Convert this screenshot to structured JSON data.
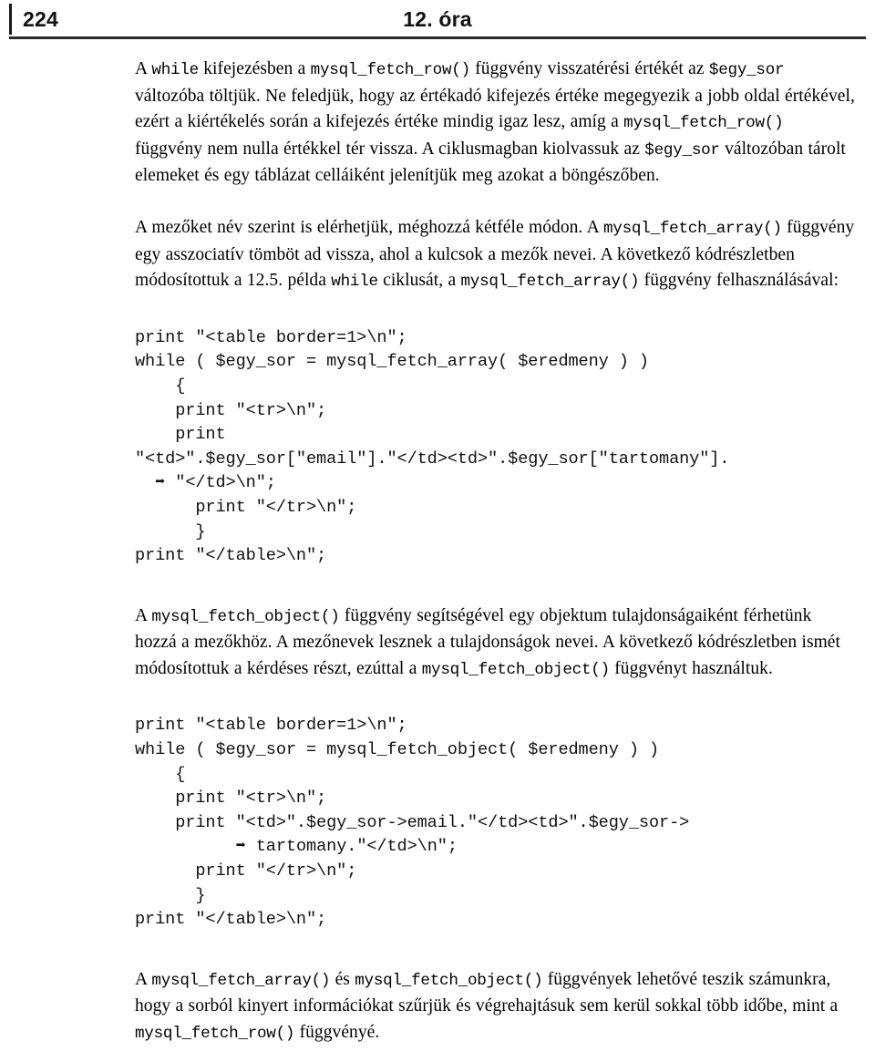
{
  "page": {
    "folio": "224",
    "running_title": "12. óra"
  },
  "body": {
    "para1": [
      "A ",
      "while",
      " kifejezésben a ",
      "mysql_fetch_row()",
      " függvény visszatérési értékét az ",
      "$egy_sor",
      " változóba töltjük. Ne feledjük, hogy az értékadó kifejezés értéke megegyezik a jobb oldal értékével, ezért a kiértékelés során a kifejezés értéke mindig igaz lesz, amíg a ",
      "mysql_fetch_row()",
      " függvény nem nulla értékkel tér vissza. A ciklusmagban kiolvassuk az ",
      "$egy_sor",
      " változóban tárolt elemeket és egy táblázat celláiként jelenítjük meg azokat a böngészőben."
    ],
    "para1_text": "A while kifejezésben a mysql_fetch_row() függvény visszatérési értékét az $egy_sor változóba töltjük. Ne feledjük, hogy az értékadó kifejezés értéke megegyezik a jobb oldal értékével, ezért a kiértékelés során a kifejezés értéke mindig igaz lesz, amíg a mysql_fetch_row() függvény nem nulla értékkel tér vissza. A ciklusmagban kiolvassuk az $egy_sor változóban tárolt elemeket és egy táblázat celláiként jelenítjük meg azokat a böngészőben.",
    "para2_text": "A mezőket név szerint is elérhetjük, méghozzá kétféle módon. A mysql_fetch_array() függvény egy asszociatív tömböt ad vissza, ahol a kulcsok a mezők nevei. A következő kódrészletben módosítottuk a 12.5. példa while ciklusát, a mysql_fetch_array() függvény felhasználásával:",
    "para3_text": "A mysql_fetch_object() függvény segítségével egy objektum tulajdonságaiként férhetünk hozzá a mezőkhöz. A mezőnevek lesznek a tulajdonságok nevei. A következő kódrészletben ismét módosítottuk a kérdéses részt, ezúttal a mysql_fetch_object() függvényt használtuk.",
    "para4_text": "A mysql_fetch_array() és mysql_fetch_object() függvények lehetővé teszik számunkra, hogy a sorból kinyert információkat szűrjük és végrehajtásuk sem kerül sokkal több időbe, mint a mysql_fetch_row() függvényé.",
    "fragments": {
      "p1_a": "A ",
      "p1_code1": "while",
      "p1_b": " kifejezésben a ",
      "p1_code2": "mysql_fetch_row()",
      "p1_c": " függvény visszatérési értékét az ",
      "p1_code3": "$egy_sor",
      "p1_d": " változóba töltjük. Ne feledjük, hogy az értékadó kifejezés értéke megegyezik a jobb oldal értékével, ezért a kiértékelés során a kifejezés értéke mindig igaz lesz, amíg a ",
      "p1_code4": "mysql_fetch_row()",
      "p1_e": " függvény nem nulla értékkel tér vissza. A ciklusmagban kiolvassuk az ",
      "p1_code5": "$egy_sor",
      "p1_f": " változóban tárolt elemeket és egy táblázat celláiként jelenítjük meg azokat a böngészőben.",
      "p2_a": "A mezőket név szerint is elérhetjük, méghozzá kétféle módon. A ",
      "p2_code1": "mysql_fetch_array()",
      "p2_b": " függvény egy asszociatív tömböt ad vissza, ahol a kulcsok a mezők nevei. A következő kódrészletben módosítottuk a 12.5. példa ",
      "p2_code2": "while",
      "p2_c": " ciklusát, a ",
      "p2_code3": "mysql_fetch_array()",
      "p2_d": " függvény felhasználásával:",
      "p3_a": "A ",
      "p3_code1": "mysql_fetch_object()",
      "p3_b": " függvény segítségével egy objektum tulajdonságaiként férhetünk hozzá a mezőkhöz. A mezőnevek lesznek a tulajdonságok nevei. A következő kódrészletben ismét módosítottuk a kérdéses részt, ezúttal a ",
      "p3_code2": "mysql_fetch_object()",
      "p3_c": " függvényt használtuk.",
      "p4_a": "A ",
      "p4_code1": "mysql_fetch_array()",
      "p4_b": " és ",
      "p4_code2": "mysql_fetch_object()",
      "p4_c": " függvények lehetővé teszik számunkra, hogy a sorból kinyert információkat szűrjük és végrehajtásuk sem kerül sokkal több időbe, mint a ",
      "p4_code3": "mysql_fetch_row()",
      "p4_d": " függvényé."
    }
  },
  "code_block_1": {
    "language": "php",
    "wrap_marker": "➡",
    "lines": [
      "print \"<table border=1>\\n\";",
      "while ( $egy_sor = mysql_fetch_array( $eredmeny ) )",
      "    {",
      "    print \"<tr>\\n\";",
      "    print",
      "\"<td>\".$egy_sor[\"email\"].\"</td><td>\".$egy_sor[\"tartomany\"].",
      "  ➡ \"</td>\\n\";",
      "      print \"</tr>\\n\";",
      "      }",
      "print \"</table>\\n\";"
    ],
    "text": "print \"<table border=1>\\n\";\nwhile ( $egy_sor = mysql_fetch_array( $eredmeny ) )\n    {\n    print \"<tr>\\n\";\n    print\n\"<td>\".$egy_sor[\"email\"].\"</td><td>\".$egy_sor[\"tartomany\"].\n  ➡ \"</td>\\n\";\n      print \"</tr>\\n\";\n      }\nprint \"</table>\\n\";"
  },
  "code_block_2": {
    "language": "php",
    "wrap_marker": "➡",
    "lines": [
      "print \"<table border=1>\\n\";",
      "while ( $egy_sor = mysql_fetch_object( $eredmeny ) )",
      "    {",
      "    print \"<tr>\\n\";",
      "    print \"<td>\".$egy_sor->email.\"</td><td>\".$egy_sor->",
      "          ➡ tartomany.\"</td>\\n\";",
      "      print \"</tr>\\n\";",
      "      }",
      "print \"</table>\\n\";"
    ],
    "text": "print \"<table border=1>\\n\";\nwhile ( $egy_sor = mysql_fetch_object( $eredmeny ) )\n    {\n    print \"<tr>\\n\";\n    print \"<td>\".$egy_sor->email.\"</td><td>\".$egy_sor->\n          ➡ tartomany.\"</td>\\n\";\n      print \"</tr>\\n\";\n      }\nprint \"</table>\\n\";"
  },
  "colors": {
    "text": "#000000",
    "rule": "#2b2b2b",
    "background": "#ffffff"
  }
}
